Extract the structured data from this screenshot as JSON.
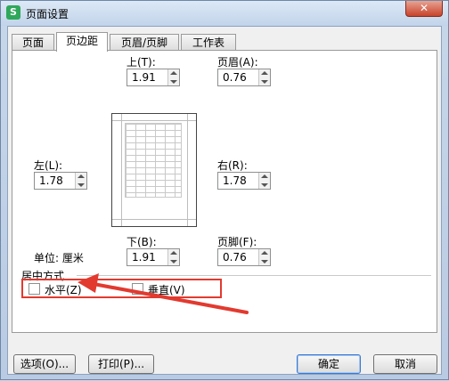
{
  "window": {
    "title": "页面设置",
    "app_icon": "S",
    "close": "✕"
  },
  "tabs": [
    {
      "label": "页面"
    },
    {
      "label": "页边距"
    },
    {
      "label": "页眉/页脚"
    },
    {
      "label": "工作表"
    }
  ],
  "active_tab": "页边距",
  "margins": {
    "top": {
      "label": "上(T):",
      "value": "1.91"
    },
    "header": {
      "label": "页眉(A):",
      "value": "0.76"
    },
    "left": {
      "label": "左(L):",
      "value": "1.78"
    },
    "right": {
      "label": "右(R):",
      "value": "1.78"
    },
    "bottom": {
      "label": "下(B):",
      "value": "1.91"
    },
    "footer": {
      "label": "页脚(F):",
      "value": "0.76"
    }
  },
  "unit_text": "单位: 厘米",
  "centering": {
    "title": "居中方式",
    "horizontal": {
      "label": "水平(Z)",
      "checked": false
    },
    "vertical": {
      "label": "垂直(V)",
      "checked": false
    }
  },
  "buttons": {
    "options": "选项(O)...",
    "print": "打印(P)...",
    "ok": "确定",
    "cancel": "取消"
  },
  "annotation_color": "#e33a30"
}
